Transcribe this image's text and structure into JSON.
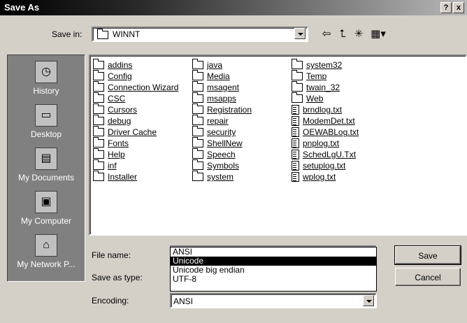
{
  "window": {
    "title": "Save As",
    "help_btn": "?",
    "close_btn": "x"
  },
  "save_in": {
    "label": "Save in:",
    "value": "WINNT"
  },
  "places": [
    {
      "label": "History",
      "icon": "history-icon"
    },
    {
      "label": "Desktop",
      "icon": "desktop-icon"
    },
    {
      "label": "My Documents",
      "icon": "my-documents-icon"
    },
    {
      "label": "My Computer",
      "icon": "my-computer-icon"
    },
    {
      "label": "My Network P...",
      "icon": "my-network-places-icon"
    }
  ],
  "files": {
    "col1": [
      {
        "name": "addins",
        "type": "folder"
      },
      {
        "name": "Config",
        "type": "folder"
      },
      {
        "name": "Connection Wizard",
        "type": "folder"
      },
      {
        "name": "CSC",
        "type": "folder"
      },
      {
        "name": "Cursors",
        "type": "folder"
      },
      {
        "name": "debug",
        "type": "folder"
      },
      {
        "name": "Driver Cache",
        "type": "folder"
      },
      {
        "name": "Fonts",
        "type": "folder"
      },
      {
        "name": "Help",
        "type": "folder"
      },
      {
        "name": "inf",
        "type": "folder"
      },
      {
        "name": "Installer",
        "type": "folder"
      }
    ],
    "col2": [
      {
        "name": "java",
        "type": "folder"
      },
      {
        "name": "Media",
        "type": "folder"
      },
      {
        "name": "msagent",
        "type": "folder"
      },
      {
        "name": "msapps",
        "type": "folder"
      },
      {
        "name": "Registration",
        "type": "folder"
      },
      {
        "name": "repair",
        "type": "folder"
      },
      {
        "name": "security",
        "type": "folder"
      },
      {
        "name": "ShellNew",
        "type": "folder"
      },
      {
        "name": "Speech",
        "type": "folder"
      },
      {
        "name": "Symbols",
        "type": "folder"
      },
      {
        "name": "system",
        "type": "folder"
      }
    ],
    "col3": [
      {
        "name": "system32",
        "type": "folder"
      },
      {
        "name": "Temp",
        "type": "folder"
      },
      {
        "name": "twain_32",
        "type": "folder"
      },
      {
        "name": "Web",
        "type": "folder"
      },
      {
        "name": "brndlog.txt",
        "type": "file"
      },
      {
        "name": "ModemDet.txt",
        "type": "file"
      },
      {
        "name": "OEWABLog.txt",
        "type": "file"
      },
      {
        "name": "pnplog.txt",
        "type": "file"
      },
      {
        "name": "SchedLgU.Txt",
        "type": "file"
      },
      {
        "name": "setuplog.txt",
        "type": "file"
      },
      {
        "name": "wplog.txt",
        "type": "file"
      }
    ]
  },
  "file_name": {
    "label": "File name:"
  },
  "save_as_type": {
    "label": "Save as type:"
  },
  "encoding": {
    "label": "Encoding:",
    "value": "ANSI",
    "options": [
      "ANSI",
      "Unicode",
      "Unicode big endian",
      "UTF-8"
    ],
    "highlighted": "Unicode"
  },
  "buttons": {
    "save": "Save",
    "cancel": "Cancel"
  }
}
